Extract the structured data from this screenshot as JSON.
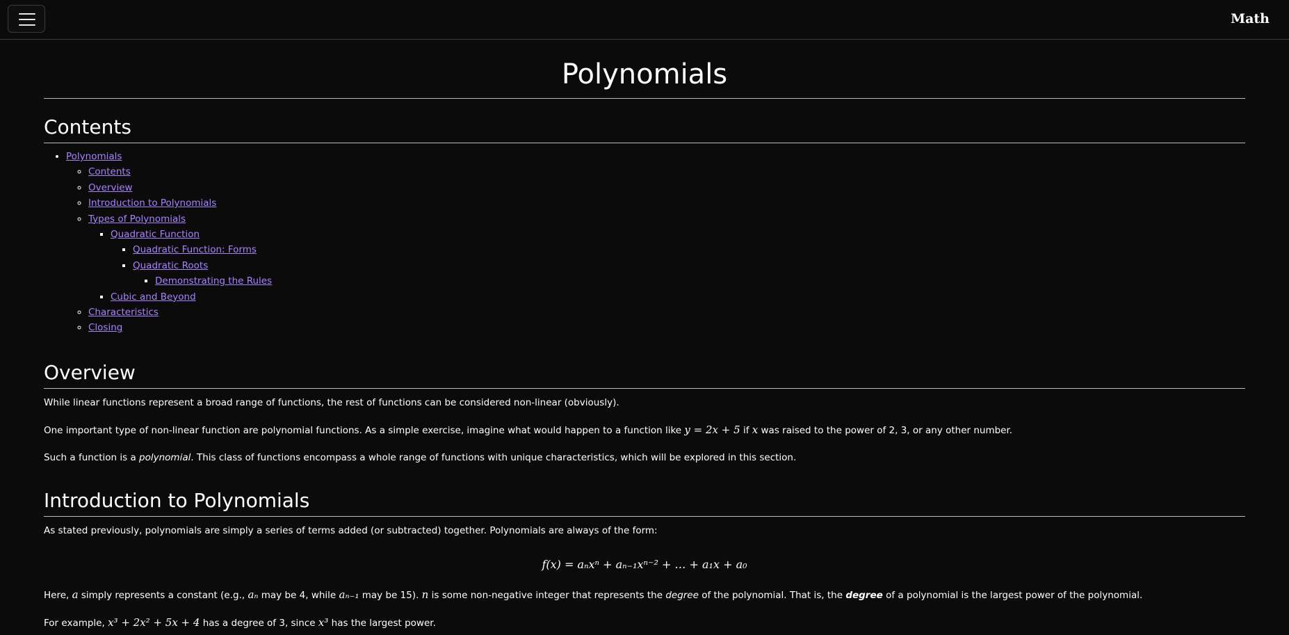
{
  "header": {
    "brand": "Math",
    "menu_icon": "hamburger-icon"
  },
  "page": {
    "title": "Polynomials"
  },
  "toc": {
    "heading": "Contents",
    "items": {
      "polynomials": "Polynomials",
      "contents": "Contents",
      "overview": "Overview",
      "intro": "Introduction to Polynomials",
      "types": "Types of Polynomials",
      "quadratic": "Quadratic Function",
      "quadratic_forms": "Quadratic Function: Forms",
      "quadratic_roots": "Quadratic Roots",
      "demonstrating": "Demonstrating the Rules",
      "cubic": "Cubic and Beyond",
      "characteristics": "Characteristics",
      "closing": "Closing"
    }
  },
  "overview": {
    "heading": "Overview",
    "p1": "While linear functions represent a broad range of functions, the rest of functions can be considered non-linear (obviously).",
    "p2_a": "One important type of non-linear function are polynomial functions. As a simple exercise, imagine what would happen to a function like ",
    "p2_math1": "y = 2x + 5",
    "p2_b": " if ",
    "p2_math2": "x",
    "p2_c": " was raised to the power of 2, 3, or any other number.",
    "p3_a": "Such a function is a ",
    "p3_em": "polynomial",
    "p3_b": ". This class of functions encompass a whole range of functions with unique characteristics, which will be explored in this section."
  },
  "intro": {
    "heading": "Introduction to Polynomials",
    "p1": "As stated previously, polynomials are simply a series of terms added (or subtracted) together. Polynomials are always of the form:",
    "formula": "f(x) = aₙxⁿ + aₙ₋₁xⁿ⁻² + … + a₁x + a₀",
    "p2_a": "Here, ",
    "p2_m1": "a",
    "p2_b": " simply represents a constant (e.g., ",
    "p2_m2": "aₙ",
    "p2_c": " may be 4, while ",
    "p2_m3": "aₙ₋₁",
    "p2_d": " may be 15). ",
    "p2_m4": "n",
    "p2_e": " is some non-negative integer that represents the ",
    "p2_em1": "degree",
    "p2_f": " of the polynomial. That is, the ",
    "p2_em2": "degree",
    "p2_g": " of a polynomial is the largest power of the polynomial.",
    "p3_a": "For example, ",
    "p3_m1": "x³ + 2x² + 5x + 4",
    "p3_b": " has a degree of 3, since ",
    "p3_m2": "x³",
    "p3_c": " has the largest power."
  }
}
